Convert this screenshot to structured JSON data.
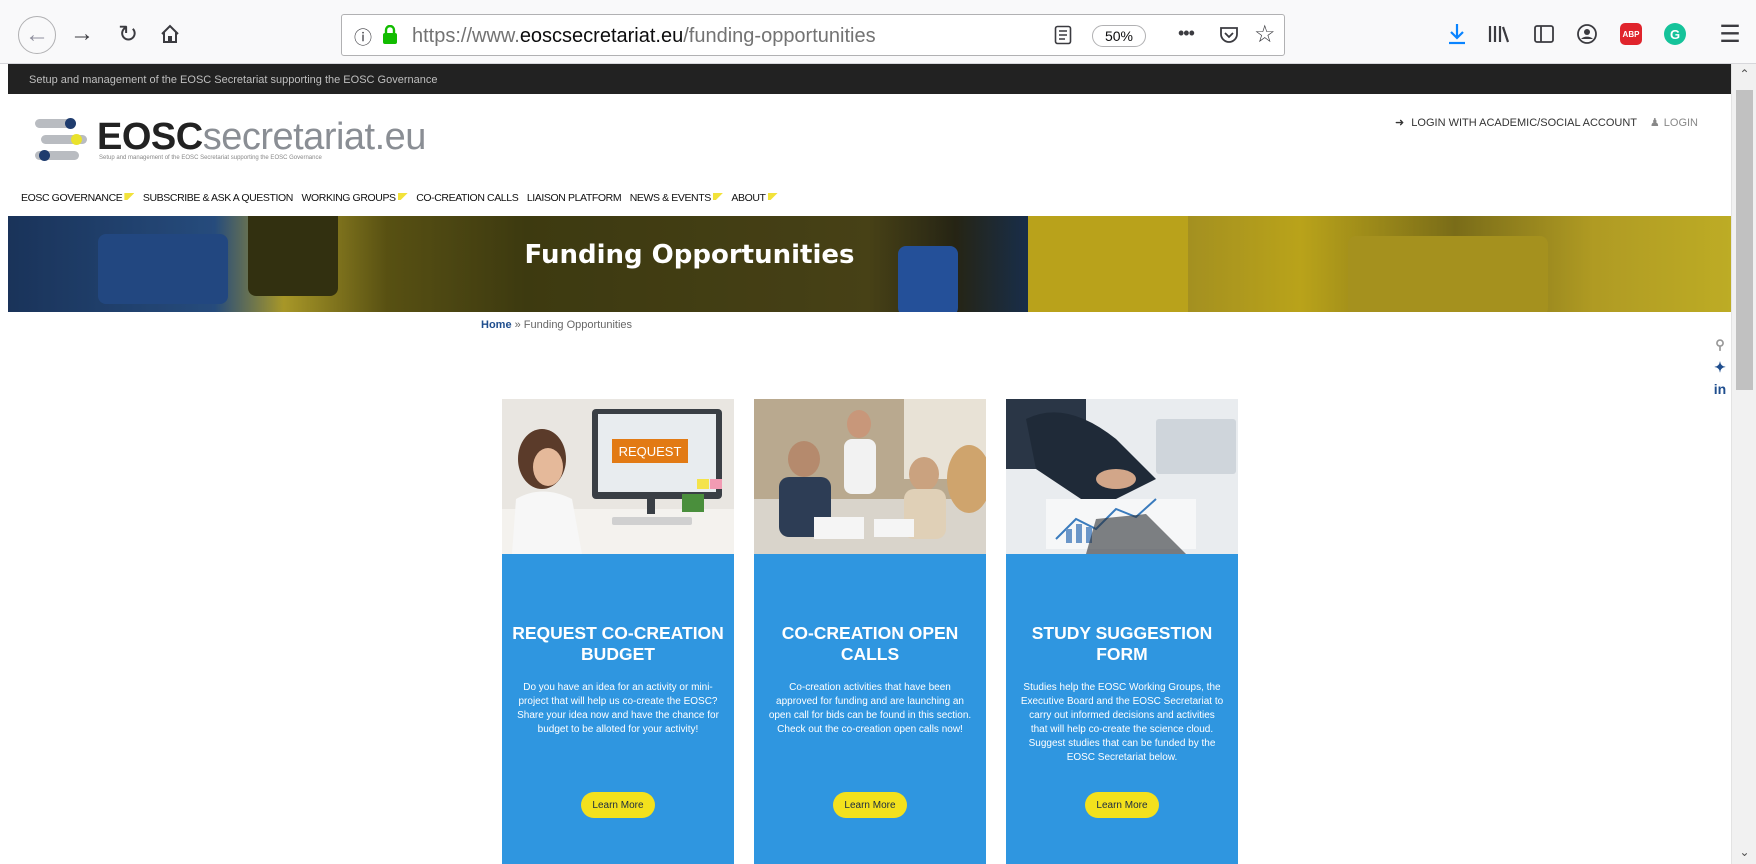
{
  "browser": {
    "url_prefix": "https://www.",
    "url_domain": "eoscsecretariat.eu",
    "url_path": "/funding-opportunities",
    "zoom": "50%",
    "abp_label": "ABP",
    "grammarly_label": "G"
  },
  "site": {
    "tagline": "Setup and management of the EOSC Secretariat supporting the EOSC Governance",
    "logo_bold": "EOSC",
    "logo_light": "secretariat.eu",
    "logo_tag": "Setup and management of the EOSC Secretariat supporting the EOSC Governance",
    "login_academic": "LOGIN WITH ACADEMIC/SOCIAL ACCOUNT",
    "login": "LOGIN"
  },
  "nav": {
    "items": [
      {
        "label": "EOSC GOVERNANCE"
      },
      {
        "label": "SUBSCRIBE & ASK A QUESTION"
      },
      {
        "label": "WORKING GROUPS"
      },
      {
        "label": "CO-CREATION CALLS"
      },
      {
        "label": "LIAISON PLATFORM"
      },
      {
        "label": "NEWS & EVENTS"
      },
      {
        "label": "ABOUT"
      }
    ]
  },
  "hero": {
    "title": "Funding Opportunities"
  },
  "breadcrumb": {
    "home": "Home",
    "separator": " » ",
    "current": "Funding Opportunities"
  },
  "cards": [
    {
      "title": "REQUEST CO-CREATION BUDGET",
      "description": "Do you have an idea for an activity or mini-project that will help us co-create the EOSC? Share your idea now and have the chance for budget to be alloted for your activity!",
      "button": "Learn More",
      "image_text": "REQUEST"
    },
    {
      "title": "CO-CREATION OPEN CALLS",
      "description": "Co-creation activities that have been approved for funding and are launching an open call for bids can be found in this section. Check out the co-creation open calls now!",
      "button": "Learn More"
    },
    {
      "title": "STUDY SUGGESTION FORM",
      "description": "Studies help the EOSC Working Groups, the Executive Board and the EOSC Secretariat to carry out informed decisions and activities that will help co-create the science cloud. Suggest studies that can be funded by the EOSC Secretariat below.",
      "button": "Learn More"
    }
  ],
  "social": {
    "twitter": "🐦",
    "linkedin": "in"
  },
  "colors": {
    "card_blue": "#2f96e0",
    "button_yellow": "#f3e11d",
    "top_strip": "#222222"
  }
}
